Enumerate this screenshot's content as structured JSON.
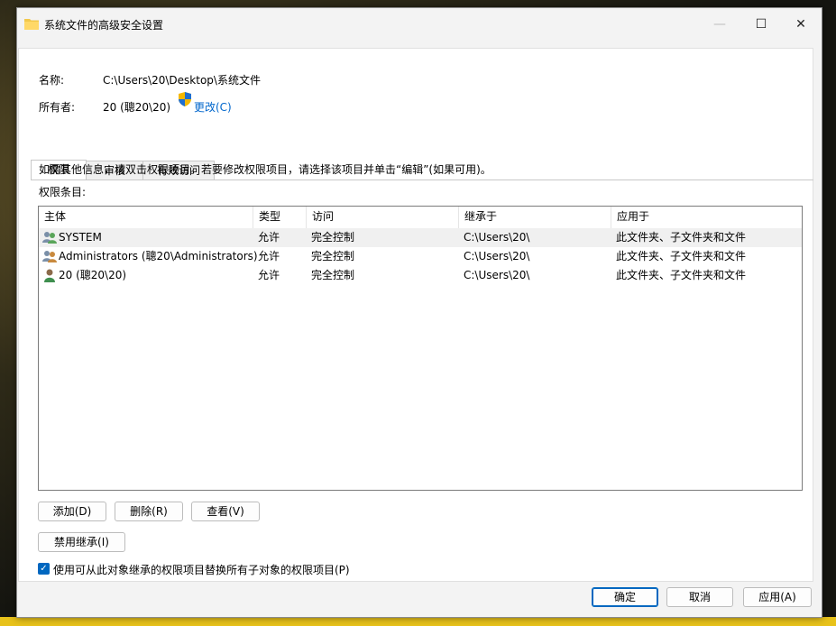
{
  "window": {
    "title": "系统文件的高级安全设置",
    "controls": {
      "minimize": "—",
      "maximize": "☐",
      "close": "✕"
    }
  },
  "info": {
    "name_label": "名称:",
    "name_value": "C:\\Users\\20\\Desktop\\系统文件",
    "owner_label": "所有者:",
    "owner_value": "20 (聰20\\20)",
    "change_link": "更改(C)"
  },
  "tabs": [
    "权限",
    "审核",
    "有效访问"
  ],
  "instructions": "如需其他信息，请双击权限项目。若要修改权限项目，请选择该项目并单击“编辑”(如果可用)。",
  "entries_label": "权限条目:",
  "table": {
    "columns": [
      "主体",
      "类型",
      "访问",
      "继承于",
      "应用于"
    ],
    "rows": [
      {
        "principal": "SYSTEM",
        "type": "允许",
        "access": "完全控制",
        "inherited": "C:\\Users\\20\\",
        "applies": "此文件夹、子文件夹和文件",
        "icon": "group-icon"
      },
      {
        "principal": "Administrators (聰20\\Administrators)",
        "type": "允许",
        "access": "完全控制",
        "inherited": "C:\\Users\\20\\",
        "applies": "此文件夹、子文件夹和文件",
        "icon": "group-icon"
      },
      {
        "principal": "20 (聰20\\20)",
        "type": "允许",
        "access": "完全控制",
        "inherited": "C:\\Users\\20\\",
        "applies": "此文件夹、子文件夹和文件",
        "icon": "user-icon"
      }
    ]
  },
  "buttons": {
    "add": "添加(D)",
    "remove": "删除(R)",
    "view": "查看(V)",
    "disable_inheritance": "禁用继承(I)",
    "ok": "确定",
    "cancel": "取消",
    "apply": "应用(A)"
  },
  "checkbox": {
    "label": "使用可从此对象继承的权限项目替换所有子对象的权限项目(P)",
    "checked": true
  },
  "colors": {
    "accent": "#0067c0",
    "link": "#0066cc"
  }
}
